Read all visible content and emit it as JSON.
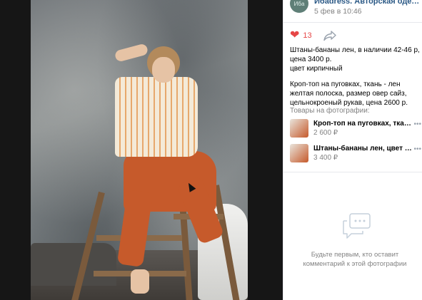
{
  "post": {
    "group_name": "Ибadress. Авторская одежда из н...",
    "avatar_text": "Ибa",
    "date": "5 фев в 10:46",
    "likes": "13"
  },
  "description": {
    "paragraph1_line1": "Штаны-бананы лен, в наличии 42-46 р,",
    "paragraph1_line2": "цена 3400 р.",
    "paragraph1_line3": "цвет кирпичный",
    "paragraph2": "Кроп-топ на пуговках, ткань - лен желтая полоска, размер овер сайз, цельнокроеный рукав, цена 2600 р."
  },
  "products": {
    "title": "Товары на фотографии:",
    "items": [
      {
        "name": "Кроп-топ на пуговках, ткань ...",
        "price": "2 600 ₽"
      },
      {
        "name": "Штаны-бананы лен, цвет кир...",
        "price": "3 400 ₽"
      }
    ]
  },
  "comments": {
    "empty_text": "Будьте первым, кто оставит комментарий к этой фотографии"
  },
  "icons": {
    "like": "heart-icon",
    "share": "share-icon",
    "empty": "comments-icon",
    "more": "ellipsis-icon"
  },
  "colors": {
    "link": "#2a5885",
    "like": "#e64646",
    "muted": "#828282"
  }
}
